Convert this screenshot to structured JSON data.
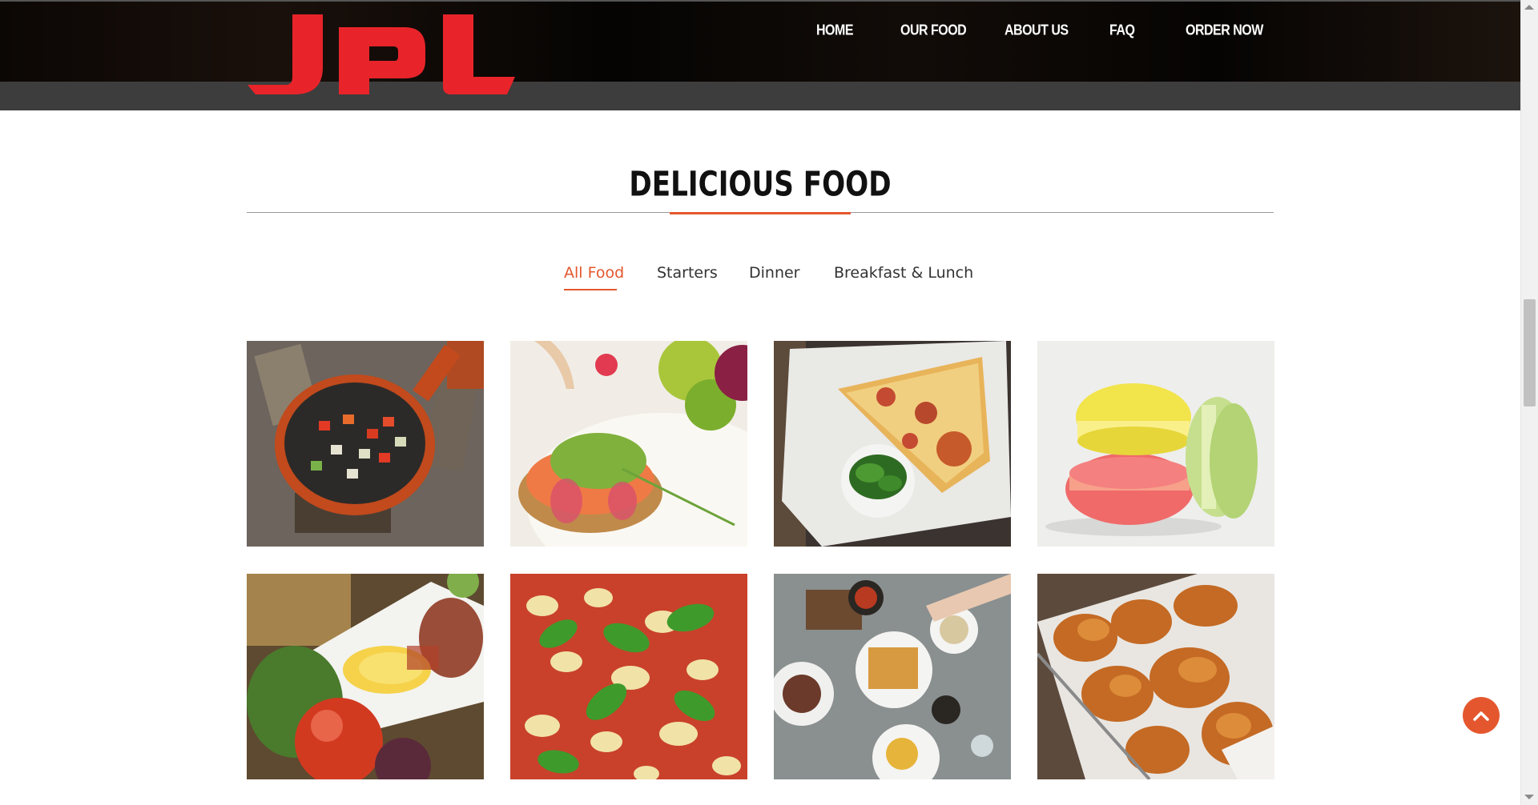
{
  "brand": {
    "logo_text": "JPL",
    "logo_color": "#e8242a"
  },
  "nav": {
    "items": [
      {
        "label": "HOME"
      },
      {
        "label": "OUR FOOD"
      },
      {
        "label": "ABOUT US"
      },
      {
        "label": "FAQ"
      },
      {
        "label": "ORDER NOW"
      }
    ]
  },
  "section": {
    "title": "DELICIOUS FOOD",
    "accent_color": "#e4572e"
  },
  "filters": {
    "tabs": [
      {
        "label": "All Food",
        "active": true
      },
      {
        "label": "Starters",
        "active": false
      },
      {
        "label": "Dinner",
        "active": false
      },
      {
        "label": "Breakfast & Lunch",
        "active": false
      }
    ]
  },
  "gallery": {
    "items": [
      {
        "subject": "vegetables-in-skillet"
      },
      {
        "subject": "salmon-toast-with-herbs"
      },
      {
        "subject": "pizza-slice-with-salad"
      },
      {
        "subject": "macarons"
      },
      {
        "subject": "rice-plate-with-tomato"
      },
      {
        "subject": "pizza-with-basil"
      },
      {
        "subject": "breakfast-table-waffles"
      },
      {
        "subject": "fried-chicken-basket"
      }
    ]
  },
  "icons": {
    "back_to_top": "chevron-up-icon"
  }
}
